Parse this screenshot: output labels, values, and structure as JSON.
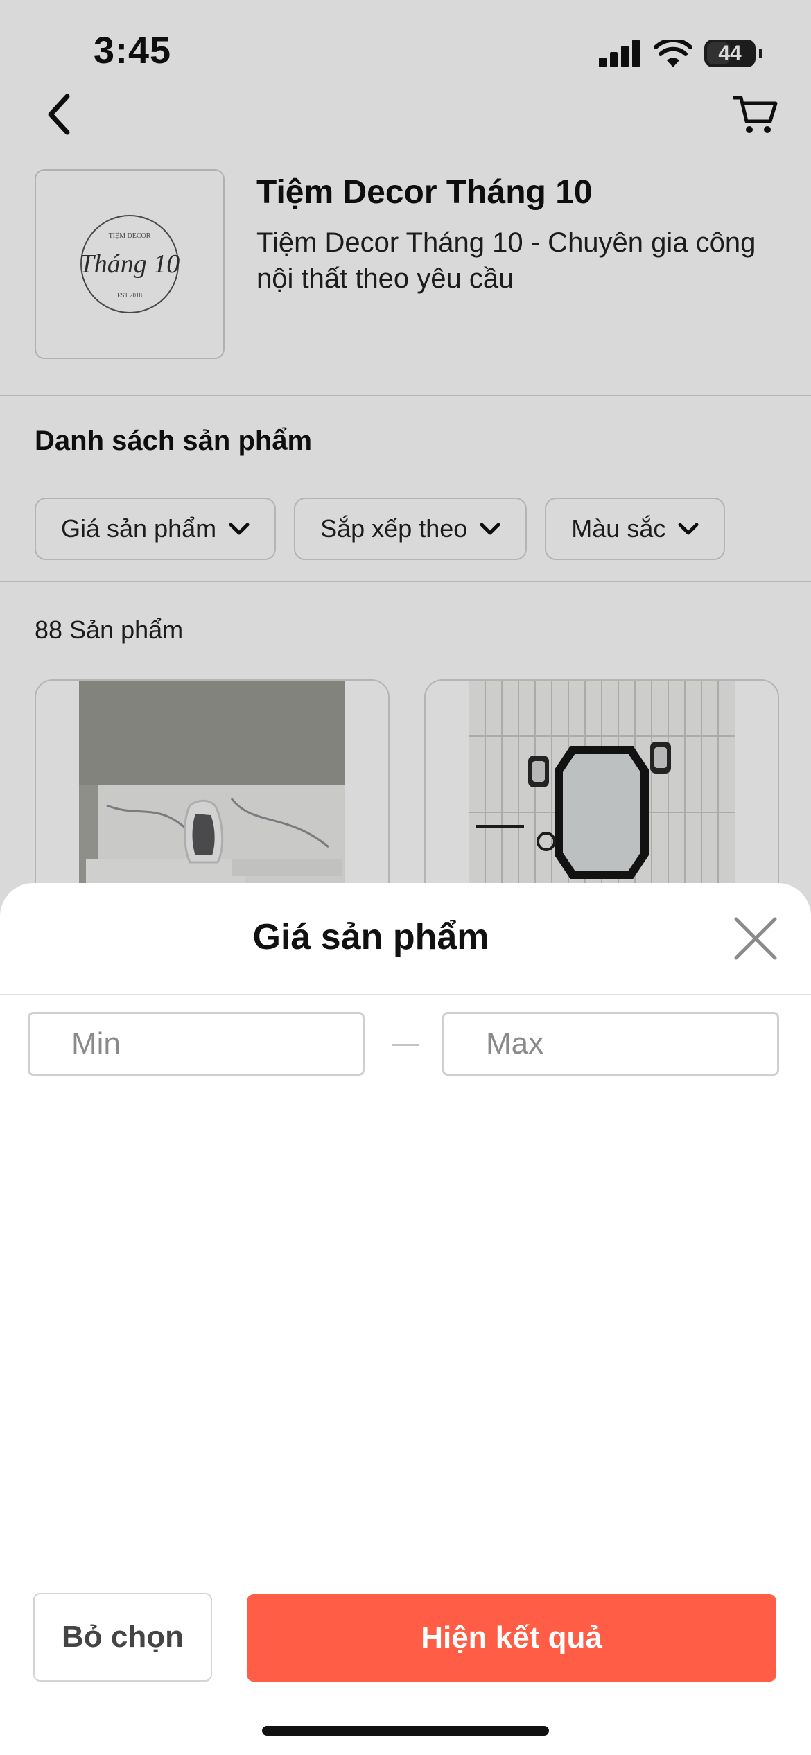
{
  "status_bar": {
    "time": "3:45",
    "battery": "44"
  },
  "nav": {
    "back_icon": "chevron-left-icon",
    "cart_icon": "cart-icon"
  },
  "shop": {
    "name": "Tiệm Decor Tháng 10",
    "description": "Tiệm Decor Tháng 10 - Chuyên gia công nội thất theo yêu cầu",
    "logo_text": "Tháng 10",
    "logo_small_top": "TIỆM DECOR",
    "logo_small_bottom": "EST 2018"
  },
  "products": {
    "section_title": "Danh sách sản phẩm",
    "filters": [
      {
        "label": "Giá sản phẩm"
      },
      {
        "label": "Sắp xếp theo"
      },
      {
        "label": "Màu sắc"
      }
    ],
    "count_label": "88 Sản phẩm"
  },
  "price_sheet": {
    "title": "Giá sản phẩm",
    "min_placeholder": "Min",
    "max_placeholder": "Max",
    "clear_label": "Bỏ chọn",
    "apply_label": "Hiện kết quả"
  },
  "colors": {
    "accent": "#ff5d45",
    "overlay": "rgba(0,0,0,0.15)"
  }
}
